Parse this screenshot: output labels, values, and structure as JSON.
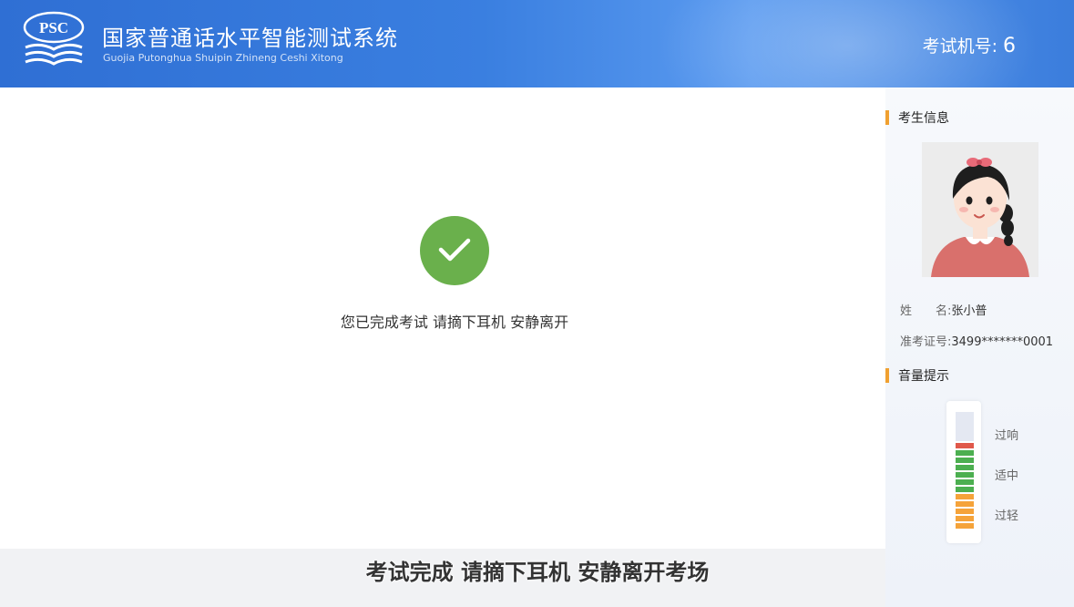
{
  "header": {
    "logo_text": "PSC",
    "title_cn": "国家普通话水平智能测试系统",
    "title_en": "Guojia Putonghua Shuipin Zhineng Ceshi Xitong",
    "machine_label": "考试机号:",
    "machine_number": "6"
  },
  "main": {
    "completion_message": "您已完成考试 请摘下耳机 安静离开",
    "subtitle": "考试完成 请摘下耳机 安静离开考场"
  },
  "sidebar": {
    "candidate_section_title": "考生信息",
    "name_label": "姓　　名:",
    "name_value": "张小普",
    "ticket_label": "准考证号:",
    "ticket_value": "3499*******0001",
    "volume_section_title": "音量提示",
    "volume_labels": {
      "too_loud": "过响",
      "moderate": "适中",
      "too_quiet": "过轻"
    }
  },
  "colors": {
    "header_blue": "#3a7fe0",
    "success_green": "#6ab04c",
    "accent_orange": "#f0a030",
    "meter_red": "#e0584a",
    "meter_green": "#4caf50",
    "meter_orange": "#f5a33a"
  }
}
